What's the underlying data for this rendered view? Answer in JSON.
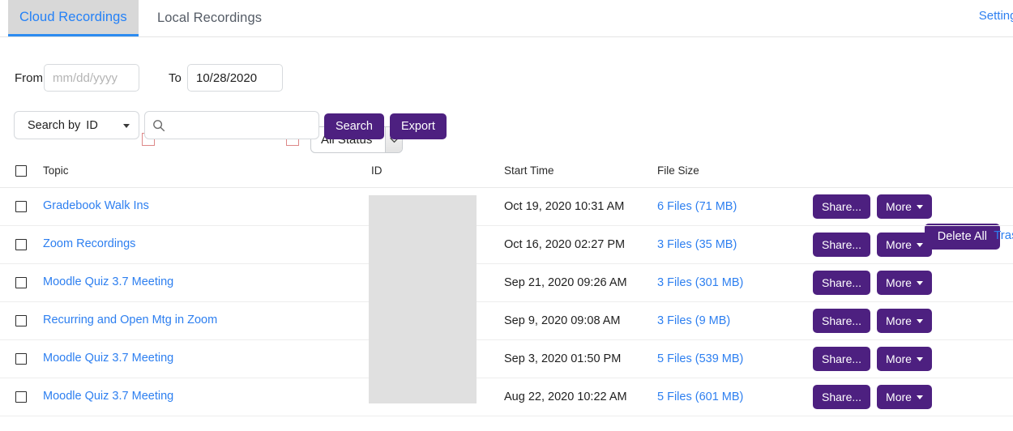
{
  "tabs": [
    {
      "label": "Cloud Recordings",
      "active": true
    },
    {
      "label": "Local Recordings",
      "active": false
    }
  ],
  "header": {
    "settings_label": "Settings"
  },
  "filters": {
    "from_label": "From",
    "from_value": "",
    "from_placeholder": "mm/dd/yyyy",
    "to_label": "To",
    "to_value": "10/28/2020",
    "to_placeholder": "mm/dd/yyyy",
    "status_selected": "All Status",
    "calendar_icon": "calendar-icon",
    "dropdown_icon": "chevron-down-icon"
  },
  "search": {
    "search_by_label": "Search by",
    "search_by_value": "ID",
    "input_value": "",
    "input_placeholder": "",
    "search_icon": "search-icon",
    "search_button": "Search",
    "export_button": "Export"
  },
  "bulk_actions": {
    "delete_all": "Delete All",
    "trash_link": "Trash"
  },
  "table": {
    "columns": [
      "Topic",
      "ID",
      "Start Time",
      "File Size"
    ],
    "id_column_redacted": true,
    "rows": [
      {
        "topic": "Gradebook Walk Ins",
        "id": "",
        "start_time": "Oct 19, 2020 10:31 AM",
        "file_size": "6 Files (71 MB)",
        "share_label": "Share...",
        "more_label": "More"
      },
      {
        "topic": "Zoom Recordings",
        "id": "",
        "start_time": "Oct 16, 2020 02:27 PM",
        "file_size": "3 Files (35 MB)",
        "share_label": "Share...",
        "more_label": "More"
      },
      {
        "topic": "Moodle Quiz 3.7 Meeting",
        "id": "",
        "start_time": "Sep 21, 2020 09:26 AM",
        "file_size": "3 Files (301 MB)",
        "share_label": "Share...",
        "more_label": "More"
      },
      {
        "topic": "Recurring and Open Mtg in Zoom",
        "id": "",
        "start_time": "Sep 9, 2020 09:08 AM",
        "file_size": "3 Files (9 MB)",
        "share_label": "Share...",
        "more_label": "More"
      },
      {
        "topic": "Moodle Quiz 3.7 Meeting",
        "id": "",
        "start_time": "Sep 3, 2020 01:50 PM",
        "file_size": "5 Files (539 MB)",
        "share_label": "Share...",
        "more_label": "More"
      },
      {
        "topic": "Moodle Quiz 3.7 Meeting",
        "id": "",
        "start_time": "Aug 22, 2020 10:22 AM",
        "file_size": "5 Files (601 MB)",
        "share_label": "Share...",
        "more_label": "More"
      }
    ]
  },
  "colors": {
    "brand_purple": "#4d2080",
    "link_blue": "#2d7ff0",
    "active_tab_bg": "#d8d8d8",
    "redaction_grey": "#e0e0e0"
  }
}
